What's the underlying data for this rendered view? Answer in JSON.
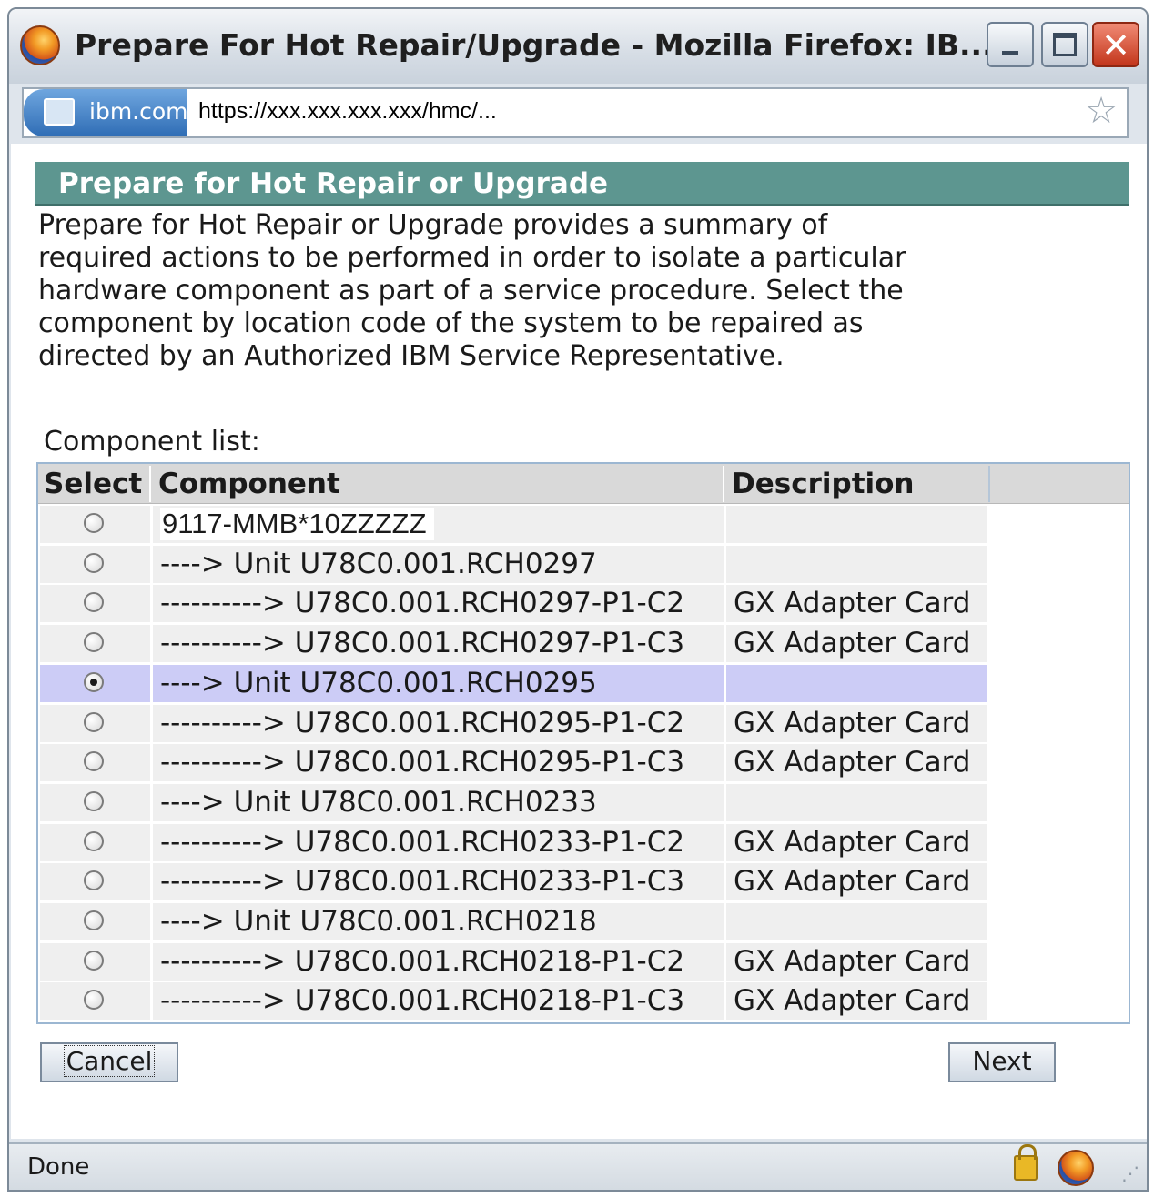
{
  "window": {
    "title": "Prepare For Hot Repair/Upgrade - Mozilla Firefox: IB...",
    "controls": {
      "minimize_icon": "minimize-icon",
      "maximize_icon": "maximize-icon",
      "close_glyph": "✕"
    }
  },
  "address": {
    "site_name": "ibm.com",
    "url": "https://xxx.xxx.xxx.xxx/hmc/...",
    "star_glyph": "☆"
  },
  "panel": {
    "header": "Prepare for Hot Repair or Upgrade",
    "description": " Prepare for Hot Repair or Upgrade provides a summary of required actions to be performed in order to isolate a particular hardware component as part of a service procedure. Select the component by location code of the system to be repaired as directed by an Authorized IBM Service Representative.",
    "component_list_label": "Component list:"
  },
  "table": {
    "columns": [
      "Select",
      "Component",
      "Description"
    ],
    "rows": [
      {
        "component": "9117-MMB*10ZZZZZ",
        "description": "",
        "selected": false
      },
      {
        "component": "----> Unit U78C0.001.RCH0297",
        "description": "",
        "selected": false
      },
      {
        "component": "----------> U78C0.001.RCH0297-P1-C2",
        "description": "GX Adapter Card",
        "selected": false
      },
      {
        "component": "----------> U78C0.001.RCH0297-P1-C3",
        "description": "GX Adapter Card",
        "selected": false
      },
      {
        "component": "----> Unit U78C0.001.RCH0295",
        "description": "",
        "selected": true
      },
      {
        "component": "----------> U78C0.001.RCH0295-P1-C2",
        "description": "GX Adapter Card",
        "selected": false
      },
      {
        "component": "----------> U78C0.001.RCH0295-P1-C3",
        "description": "GX Adapter Card",
        "selected": false
      },
      {
        "component": "----> Unit U78C0.001.RCH0233",
        "description": "",
        "selected": false
      },
      {
        "component": "----------> U78C0.001.RCH0233-P1-C2",
        "description": "GX Adapter Card",
        "selected": false
      },
      {
        "component": "----------> U78C0.001.RCH0233-P1-C3",
        "description": "GX Adapter Card",
        "selected": false
      },
      {
        "component": "----> Unit U78C0.001.RCH0218",
        "description": "",
        "selected": false
      },
      {
        "component": "----------> U78C0.001.RCH0218-P1-C2",
        "description": "GX Adapter Card",
        "selected": false
      },
      {
        "component": "----------> U78C0.001.RCH0218-P1-C3",
        "description": "GX Adapter Card",
        "selected": false
      }
    ]
  },
  "buttons": {
    "cancel": "Cancel",
    "next": "Next"
  },
  "status": {
    "text": "Done",
    "grip_glyph": "⋰"
  },
  "colors": {
    "header_bar": "#5d9690",
    "selected_row": "#ccccf6",
    "row_bg": "#efefef"
  }
}
